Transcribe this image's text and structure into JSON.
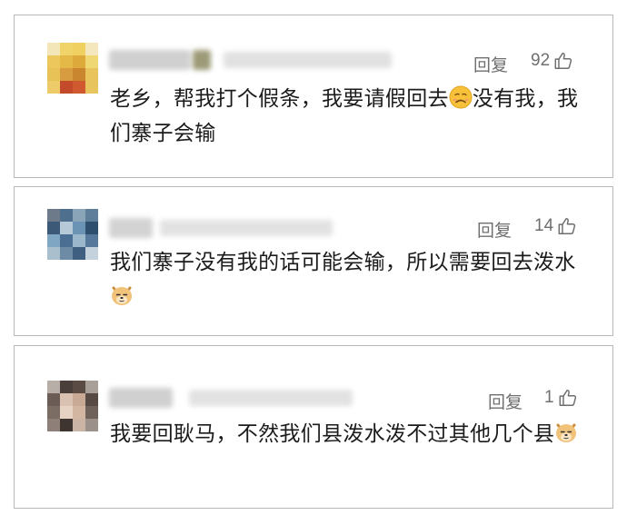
{
  "comments": [
    {
      "text_before": "老乡，帮我打个假条，我要请假回去",
      "emoji": "worried-face-emoji",
      "text_after": "没有我，我们寨子会输",
      "reply_label": "回复",
      "likes": "92"
    },
    {
      "text_before": "我们寨子没有我的话可能会输，所以需要回去泼水",
      "emoji": "doge-emoji",
      "text_after": "",
      "reply_label": "回复",
      "likes": "14"
    },
    {
      "text_before": "我要回耿马，不然我们县泼水泼不过其他几个县",
      "emoji": "doge-emoji",
      "text_after": "",
      "reply_label": "回复",
      "likes": "1"
    }
  ],
  "colors": {
    "border": "#b9b9b9",
    "text": "#1b1b1b",
    "meta": "#6f6f6f"
  },
  "icons": {
    "like": "thumbs-up-icon"
  }
}
